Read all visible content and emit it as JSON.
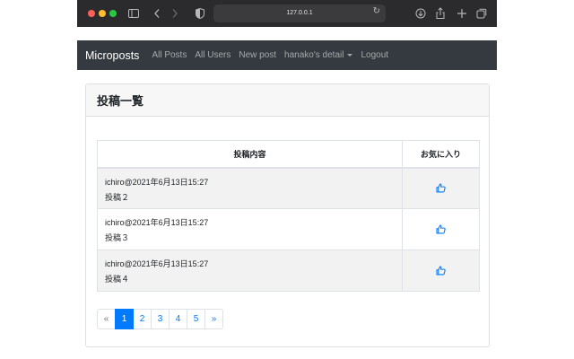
{
  "browser": {
    "url": "127.0.0.1",
    "icons": {
      "sidebar": "sidebar-icon",
      "back": "chevron-left-icon",
      "forward": "chevron-right-icon",
      "privacy": "shield-icon",
      "reload": "reload-icon",
      "download": "download-icon",
      "share": "share-icon",
      "new_tab": "plus-icon",
      "tabs": "tabs-overview-icon"
    }
  },
  "navbar": {
    "brand": "Microposts",
    "links": [
      "All Posts",
      "All Users",
      "New post",
      "hanako's detail",
      "Logout"
    ]
  },
  "card": {
    "title": "投稿一覧"
  },
  "table": {
    "headers": [
      "投稿内容",
      "お気に入り"
    ],
    "rows": [
      {
        "author_time": "ichiro@2021年6月13日15:27",
        "content": "投稿２",
        "favorite_icon": "thumbs-up-icon"
      },
      {
        "author_time": "ichiro@2021年6月13日15:27",
        "content": "投稿３",
        "favorite_icon": "thumbs-up-icon"
      },
      {
        "author_time": "ichiro@2021年6月13日15:27",
        "content": "投稿４",
        "favorite_icon": "thumbs-up-icon"
      }
    ]
  },
  "pagination": {
    "prev": "«",
    "pages": [
      "1",
      "2",
      "3",
      "4",
      "5"
    ],
    "next": "»",
    "current": "1"
  },
  "colors": {
    "navbar_bg": "#343a40",
    "link": "#007bff",
    "active_page": "#007bff",
    "card_header_bg": "#f7f7f7"
  }
}
